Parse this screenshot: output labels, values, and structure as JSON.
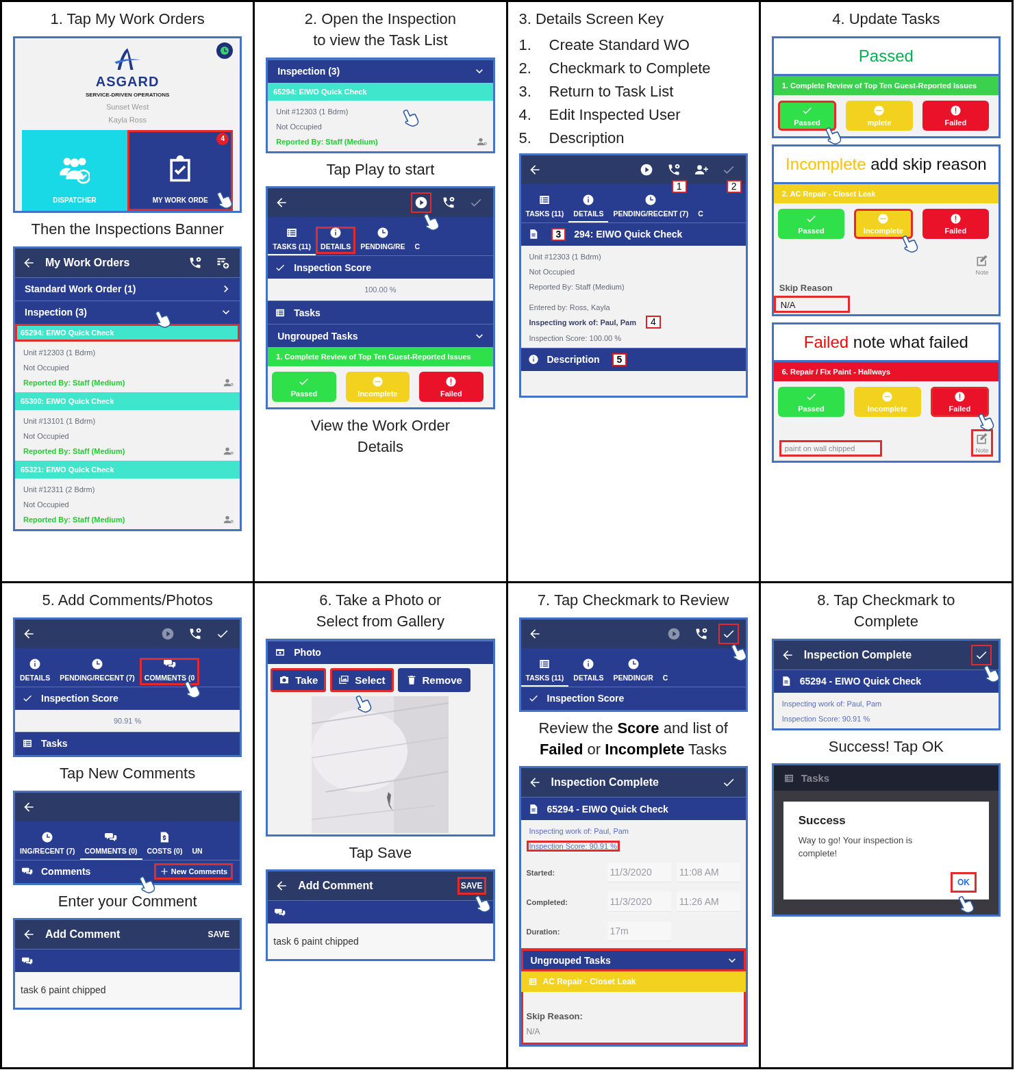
{
  "cells": [
    {
      "items": [
        {
          "kind": "caption",
          "text": "1. Tap My Work Orders"
        },
        {
          "kind": "screen",
          "blocks": [
            {
              "kind": "home",
              "brand": "ASGARD",
              "tagline": "SERVICE-DRIVEN OPERATIONS",
              "site": "Sunset West",
              "user": "Kayla Ross",
              "tiles": [
                {
                  "kind": "dispatcher",
                  "label": "DISPATCHER",
                  "highlighted": false,
                  "tap": false
                },
                {
                  "kind": "work_orders",
                  "label": "MY WORK ORDE",
                  "badge": "4",
                  "highlighted": true,
                  "tap": true
                }
              ]
            }
          ]
        },
        {
          "kind": "caption",
          "text": "Then the Inspections Banner"
        },
        {
          "kind": "screen",
          "blocks": [
            {
              "kind": "appbar",
              "title": "My Work Orders",
              "icons": [
                {
                  "kind": "call",
                  "dimmed": false,
                  "highlighted": false,
                  "tap": false
                },
                {
                  "kind": "calendar",
                  "dimmed": false,
                  "highlighted": false,
                  "tap": false
                }
              ]
            },
            {
              "kind": "group_bar",
              "title": "Standard Work Order (1)",
              "expanded": false,
              "highlighted": false,
              "tap": false
            },
            {
              "kind": "group_bar",
              "title": "Inspection (3)",
              "expanded": true,
              "highlighted": false,
              "tap": true
            },
            {
              "kind": "item_header",
              "text": "65294:  EIWO Quick Check",
              "highlighted": true
            },
            {
              "kind": "detail",
              "assignee": true,
              "lines": [
                {
                  "text": "Unit #12303 (1 Bdrm)",
                  "kind": "plain"
                },
                {
                  "text": "Not Occupied",
                  "kind": "plain"
                },
                {
                  "text": "Reported By: Staff  (Medium)",
                  "kind": "reporter"
                }
              ]
            },
            {
              "kind": "item_header",
              "text": "65300:  EIWO Quick Check",
              "highlighted": false
            },
            {
              "kind": "detail",
              "assignee": true,
              "lines": [
                {
                  "text": "Unit #13101 (1 Bdrm)",
                  "kind": "plain"
                },
                {
                  "text": "Not Occupied",
                  "kind": "plain"
                },
                {
                  "text": "Reported By: Staff  (Medium)",
                  "kind": "reporter"
                }
              ]
            },
            {
              "kind": "item_header",
              "text": "65321:  EIWO Quick Check",
              "highlighted": false
            },
            {
              "kind": "detail",
              "assignee": true,
              "lines": [
                {
                  "text": "Unit #12311 (2 Bdrm)",
                  "kind": "plain"
                },
                {
                  "text": "Not Occupied",
                  "kind": "plain"
                },
                {
                  "text": "Reported By: Staff  (Medium)",
                  "kind": "reporter"
                }
              ]
            }
          ]
        }
      ]
    },
    {
      "items": [
        {
          "kind": "caption",
          "text": "2. Open the Inspection\nto view the Task List"
        },
        {
          "kind": "screen",
          "blocks": [
            {
              "kind": "group_bar",
              "title": "Inspection (3)",
              "expanded": true,
              "highlighted": false,
              "tap": false
            },
            {
              "kind": "item_header",
              "text": "65294:  EIWO Quick Check",
              "highlighted": false
            },
            {
              "kind": "detail",
              "assignee": true,
              "tap": true,
              "lines": [
                {
                  "text": "Unit #12303 (1 Bdrm)",
                  "kind": "plain"
                },
                {
                  "text": "Not Occupied",
                  "kind": "plain"
                },
                {
                  "text": "Reported By: Staff  (Medium)",
                  "kind": "reporter"
                }
              ]
            }
          ]
        },
        {
          "kind": "caption",
          "text": "Tap Play to start"
        },
        {
          "kind": "screen",
          "blocks": [
            {
              "kind": "appbar",
              "icons": [
                {
                  "kind": "play",
                  "dimmed": false,
                  "highlighted": true,
                  "tap": true
                },
                {
                  "kind": "call",
                  "dimmed": false,
                  "highlighted": false,
                  "tap": false
                },
                {
                  "kind": "check",
                  "dimmed": true,
                  "highlighted": false,
                  "tap": false
                }
              ]
            },
            {
              "kind": "tabs",
              "tabs": [
                {
                  "kind": "tasks",
                  "label": "TASKS (11)",
                  "selected": true,
                  "highlighted": false
                },
                {
                  "kind": "details",
                  "label": "DETAILS",
                  "selected": false,
                  "highlighted": true
                },
                {
                  "kind": "pending",
                  "label": "PENDING/RE",
                  "selected": false,
                  "highlighted": false
                },
                {
                  "kind": "other",
                  "label": "C",
                  "selected": false,
                  "highlighted": false
                }
              ]
            },
            {
              "kind": "score_bar",
              "title": "Inspection Score",
              "highlighted": false,
              "tap": false
            },
            {
              "kind": "score",
              "text": "100.00 %"
            },
            {
              "kind": "tasks_bar",
              "title": "Tasks",
              "highlighted": false,
              "tap": false
            },
            {
              "kind": "group_bar",
              "title": "Ungrouped Tasks",
              "expanded": true,
              "highlighted": false,
              "tap": false
            },
            {
              "kind": "task",
              "color": "#2fe04a",
              "title": "1.  Complete Review of Top Ten Guest-Reported Issues",
              "buttons": [
                {
                  "kind": "passed",
                  "label": "Passed",
                  "selected": false,
                  "tap": false
                },
                {
                  "kind": "incomplete",
                  "label": "Incomplete",
                  "selected": false,
                  "tap": false
                },
                {
                  "kind": "failed",
                  "label": "Failed",
                  "selected": false,
                  "tap": false
                }
              ]
            }
          ]
        },
        {
          "kind": "caption",
          "text": "View the Work Order\nDetails"
        }
      ]
    },
    {
      "items": [
        {
          "kind": "heading",
          "text": "3. Details Screen Key"
        },
        {
          "kind": "key_list",
          "entries": [
            {
              "number": "1.",
              "text": "Create Standard WO"
            },
            {
              "number": "2.",
              "text": "Checkmark to Complete"
            },
            {
              "number": "3.",
              "text": "Return to Task List"
            },
            {
              "number": "4.",
              "text": "Edit Inspected User"
            },
            {
              "number": "5.",
              "text": "Description"
            }
          ]
        },
        {
          "kind": "screen",
          "blocks": [
            {
              "kind": "appbar",
              "icons": [
                {
                  "kind": "play",
                  "dimmed": false,
                  "highlighted": false,
                  "tap": false
                },
                {
                  "kind": "call",
                  "dimmed": false,
                  "highlighted": false,
                  "tap": false,
                  "callout": "1"
                },
                {
                  "kind": "adduser",
                  "dimmed": false,
                  "highlighted": false,
                  "tap": false
                },
                {
                  "kind": "check",
                  "dimmed": true,
                  "highlighted": false,
                  "tap": false,
                  "callout": "2"
                }
              ]
            },
            {
              "kind": "tabs",
              "tabs": [
                {
                  "kind": "tasks",
                  "label": "TASKS (11)",
                  "selected": false,
                  "highlighted": false
                },
                {
                  "kind": "details",
                  "label": "DETAILS",
                  "selected": true,
                  "highlighted": false
                },
                {
                  "kind": "pending",
                  "label": "PENDING/RECENT (7)",
                  "selected": false,
                  "highlighted": false
                },
                {
                  "kind": "other",
                  "label": "C",
                  "selected": false,
                  "highlighted": false
                }
              ]
            },
            {
              "kind": "doc_bar",
              "title": "294: EIWO Quick Check",
              "highlighted": false,
              "tap": false,
              "callout": "3"
            },
            {
              "kind": "detail",
              "assignee": false,
              "lines": [
                {
                  "text": "Unit #12303 (1 Bdrm)",
                  "kind": "plain"
                },
                {
                  "text": "Not Occupied",
                  "kind": "plain"
                },
                {
                  "text": "Reported By: Staff  (Medium)",
                  "kind": "plain"
                }
              ]
            },
            {
              "kind": "detail",
              "assignee": false,
              "lines": [
                {
                  "text": "Entered by: Ross, Kayla",
                  "kind": "plain"
                },
                {
                  "text": "Inspecting work of: Paul, Pam",
                  "kind": "bold",
                  "callout": "4"
                },
                {
                  "text": "Inspection Score: 100.00 %",
                  "kind": "plain"
                }
              ]
            },
            {
              "kind": "info_bar",
              "title": "Description",
              "highlighted": false,
              "tap": false,
              "callout": "5"
            },
            {
              "kind": "blank"
            }
          ]
        }
      ]
    },
    {
      "items": [
        {
          "kind": "caption",
          "text": "4. Update Tasks"
        },
        {
          "kind": "screen",
          "blocks": [
            {
              "kind": "status_header",
              "color": "#00b050",
              "status_text": "Passed"
            },
            {
              "kind": "task",
              "color": "#3bd14e",
              "title": "1.  Complete Review of Top Ten Guest-Reported Issues",
              "buttons": [
                {
                  "kind": "passed",
                  "label": "Passed",
                  "selected": true,
                  "tap": true
                },
                {
                  "kind": "incomplete",
                  "label": "mplete",
                  "selected": false,
                  "tap": false
                },
                {
                  "kind": "failed",
                  "label": "Failed",
                  "selected": false,
                  "tap": false
                }
              ]
            }
          ]
        },
        {
          "kind": "screen",
          "blocks": [
            {
              "kind": "status_header",
              "color": "#ffc000",
              "status_text": "Incomplete",
              "rest": " add skip reason"
            },
            {
              "kind": "task",
              "color": "#f3d11f",
              "title": "2.  AC Repair - Closet Leak",
              "buttons": [
                {
                  "kind": "passed",
                  "label": "Passed",
                  "selected": false,
                  "tap": false
                },
                {
                  "kind": "incomplete",
                  "label": "Incomplete",
                  "selected": true,
                  "tap": true
                },
                {
                  "kind": "failed",
                  "label": "Failed",
                  "selected": false,
                  "tap": false
                }
              ],
              "note": {
                "label": "Note",
                "highlighted": false
              },
              "skip": {
                "label": "Skip Reason",
                "value": "N/A",
                "highlighted": true
              }
            }
          ]
        },
        {
          "kind": "screen",
          "blocks": [
            {
              "kind": "status_header",
              "color": "#ff0000",
              "status_text": "Failed",
              "rest": " note what failed"
            },
            {
              "kind": "task",
              "color": "#ea1228",
              "title": "6.  Repair / Fix Paint - Hallways",
              "buttons": [
                {
                  "kind": "passed",
                  "label": "Passed",
                  "selected": false,
                  "tap": false
                },
                {
                  "kind": "incomplete",
                  "label": "Incomplete",
                  "selected": false,
                  "tap": false
                },
                {
                  "kind": "failed",
                  "label": "Failed",
                  "selected": true,
                  "tap": true
                }
              ],
              "note": {
                "label": "Note",
                "highlighted": true
              },
              "remark": {
                "placeholder": "paint on wall chipped",
                "highlighted": true
              }
            }
          ]
        }
      ]
    },
    {
      "items": [
        {
          "kind": "caption",
          "text": "5. Add Comments/Photos"
        },
        {
          "kind": "screen",
          "blocks": [
            {
              "kind": "appbar",
              "icons": [
                {
                  "kind": "play",
                  "dimmed": true,
                  "highlighted": false,
                  "tap": false
                },
                {
                  "kind": "call",
                  "dimmed": false,
                  "highlighted": false,
                  "tap": false
                },
                {
                  "kind": "check",
                  "dimmed": false,
                  "highlighted": false,
                  "tap": false
                }
              ]
            },
            {
              "kind": "tabs",
              "tabs": [
                {
                  "kind": "details",
                  "label": "DETAILS",
                  "selected": false,
                  "highlighted": false
                },
                {
                  "kind": "pending",
                  "label": "PENDING/RECENT (7)",
                  "selected": false,
                  "highlighted": false
                },
                {
                  "kind": "comments",
                  "label": "COMMENTS (0",
                  "selected": false,
                  "highlighted": true,
                  "tap": true
                }
              ]
            },
            {
              "kind": "score_bar",
              "title": "Inspection Score",
              "highlighted": false,
              "tap": false
            },
            {
              "kind": "score",
              "text": "90.91 %"
            },
            {
              "kind": "tasks_bar",
              "title": "Tasks",
              "highlighted": false,
              "tap": false
            }
          ]
        },
        {
          "kind": "caption",
          "text": "Tap New Comments"
        },
        {
          "kind": "screen",
          "blocks": [
            {
              "kind": "appbar"
            },
            {
              "kind": "tabs",
              "tabs": [
                {
                  "kind": "pending",
                  "label": "ING/RECENT (7)",
                  "selected": false,
                  "highlighted": false
                },
                {
                  "kind": "comments",
                  "label": "COMMENTS (0)",
                  "selected": true,
                  "highlighted": false
                },
                {
                  "kind": "costs",
                  "label": "COSTS (0)",
                  "selected": false,
                  "highlighted": false
                },
                {
                  "kind": "other",
                  "label": "UN",
                  "selected": false,
                  "highlighted": false
                }
              ]
            },
            {
              "kind": "comments_bar",
              "title": "Comments",
              "highlighted": false,
              "tap": false,
              "action": {
                "label": "New Comments",
                "highlighted": true,
                "tap": true
              }
            }
          ]
        },
        {
          "kind": "caption",
          "text": "Enter your Comment"
        },
        {
          "kind": "screen",
          "blocks": [
            {
              "kind": "appbar",
              "title": "Add Comment",
              "action": {
                "label": "SAVE",
                "highlighted": false,
                "tap": false
              }
            },
            {
              "kind": "comments_bar",
              "highlighted": false,
              "tap": false
            },
            {
              "kind": "field",
              "value": "task 6 paint chipped"
            }
          ]
        }
      ]
    },
    {
      "items": [
        {
          "kind": "caption",
          "text": "6. Take a Photo or\nSelect from Gallery"
        },
        {
          "kind": "screen",
          "blocks": [
            {
              "kind": "photo_bar",
              "title": "Photo",
              "highlighted": false,
              "tap": false
            },
            {
              "kind": "photo_actions",
              "buttons": [
                {
                  "kind": "take",
                  "label": "Take",
                  "highlighted": true,
                  "tap": false
                },
                {
                  "kind": "select",
                  "label": "Select",
                  "highlighted": true,
                  "tap": true
                },
                {
                  "kind": "remove",
                  "label": "Remove",
                  "highlighted": false,
                  "tap": false
                }
              ]
            },
            {
              "kind": "picture"
            }
          ]
        },
        {
          "kind": "caption",
          "text": "Tap Save"
        },
        {
          "kind": "screen",
          "blocks": [
            {
              "kind": "appbar",
              "title": "Add Comment",
              "action": {
                "label": "SAVE",
                "highlighted": true,
                "tap": true
              }
            },
            {
              "kind": "comments_bar",
              "highlighted": false,
              "tap": false
            },
            {
              "kind": "field",
              "value": "task 6 paint chipped"
            }
          ]
        }
      ]
    },
    {
      "items": [
        {
          "kind": "caption",
          "text": "7. Tap Checkmark to Review"
        },
        {
          "kind": "screen",
          "blocks": [
            {
              "kind": "appbar",
              "icons": [
                {
                  "kind": "play",
                  "dimmed": true,
                  "highlighted": false,
                  "tap": false
                },
                {
                  "kind": "call",
                  "dimmed": false,
                  "highlighted": false,
                  "tap": false
                },
                {
                  "kind": "check",
                  "dimmed": false,
                  "highlighted": true,
                  "tap": true
                }
              ]
            },
            {
              "kind": "tabs",
              "tabs": [
                {
                  "kind": "tasks",
                  "label": "TASKS (11)",
                  "selected": true,
                  "highlighted": false
                },
                {
                  "kind": "details",
                  "label": "DETAILS",
                  "selected": false,
                  "highlighted": false
                },
                {
                  "kind": "pending",
                  "label": "PENDING/R",
                  "selected": false,
                  "highlighted": false
                },
                {
                  "kind": "other",
                  "label": "C",
                  "selected": false,
                  "highlighted": false
                }
              ]
            },
            {
              "kind": "score_bar",
              "title": "Inspection Score",
              "highlighted": false,
              "tap": false
            }
          ]
        },
        {
          "kind": "caption",
          "text": "Review the **Score** and list of\n**Failed** or **Incomplete** Tasks"
        },
        {
          "kind": "screen",
          "blocks": [
            {
              "kind": "appbar",
              "title": "Inspection Complete",
              "icons": [
                {
                  "kind": "check",
                  "dimmed": false,
                  "highlighted": false,
                  "tap": false
                }
              ]
            },
            {
              "kind": "doc_bar",
              "title": "65294 - EIWO Quick Check",
              "highlighted": false,
              "tap": false
            },
            {
              "kind": "detail",
              "assignee": false,
              "lines": [
                {
                  "text": "Inspecting work of: Paul, Pam",
                  "kind": "blue",
                  "highlighted": false
                },
                {
                  "text": "Inspection Score: 90.91 %",
                  "kind": "blue",
                  "highlighted": true
                }
              ]
            },
            {
              "kind": "dates",
              "rows": [
                {
                  "label": "Started:",
                  "date": "11/3/2020",
                  "time": "11:08 AM"
                },
                {
                  "label": "Completed:",
                  "date": "11/3/2020",
                  "time": "11:26 AM"
                },
                {
                  "label": "Duration:",
                  "date": "17m"
                }
              ]
            },
            {
              "kind": "group_bar",
              "title": "Ungrouped Tasks",
              "expanded": true,
              "highlighted": true,
              "tap": false
            },
            {
              "kind": "task_summary",
              "color": "#f3d11f",
              "title": "AC Repair - Closet Leak",
              "skip_label": "Skip Reason:",
              "skip_value": "N/A",
              "highlighted": true
            }
          ]
        }
      ]
    },
    {
      "items": [
        {
          "kind": "caption",
          "text": "8. Tap Checkmark to\nComplete"
        },
        {
          "kind": "screen",
          "blocks": [
            {
              "kind": "appbar",
              "title": "Inspection Complete",
              "icons": [
                {
                  "kind": "check",
                  "dimmed": false,
                  "highlighted": true,
                  "tap": true
                }
              ]
            },
            {
              "kind": "doc_bar",
              "title": "65294 - EIWO Quick Check",
              "highlighted": false,
              "tap": false
            },
            {
              "kind": "detail",
              "assignee": false,
              "lines": [
                {
                  "text": "Inspecting work of: Paul, Pam",
                  "kind": "blue"
                },
                {
                  "text": "Inspection Score: 90.91 %",
                  "kind": "blue"
                }
              ]
            }
          ]
        },
        {
          "kind": "caption",
          "text": "Success! Tap OK"
        },
        {
          "kind": "screen",
          "blocks": [
            {
              "kind": "dialog",
              "backdrop_title": "Tasks",
              "title": "Success",
              "message": "Way to go! Your inspection is complete!",
              "button": {
                "label": "OK",
                "highlighted": true,
                "tap": true
              }
            }
          ]
        }
      ]
    }
  ]
}
